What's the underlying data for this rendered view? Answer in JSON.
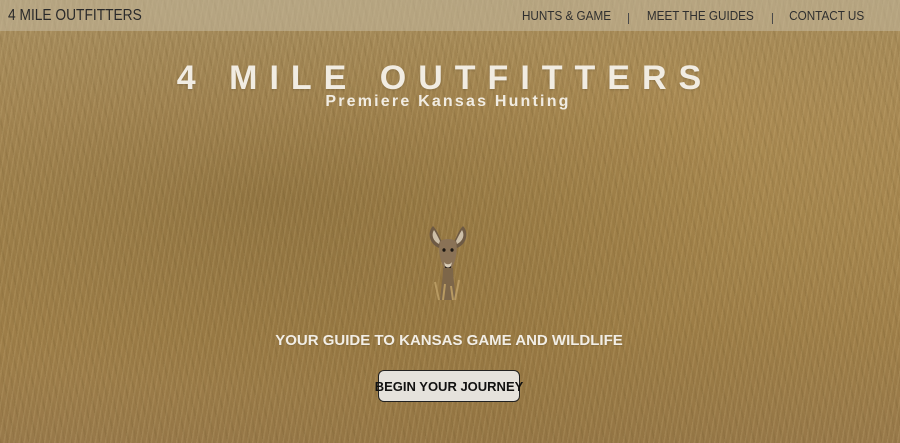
{
  "navbar": {
    "brand": "4 MILE OUTFITTERS",
    "links": [
      {
        "label": "HUNTS & GAME"
      },
      {
        "label": "MEET THE GUIDES"
      },
      {
        "label": "CONTACT US"
      }
    ]
  },
  "hero": {
    "title": "4 MILE OUTFITTERS",
    "subtitle": "Premiere Kansas Hunting",
    "tagline": "YOUR GUIDE TO KANSAS GAME AND WILDLIFE",
    "cta_label": "BEGIN YOUR JOURNEY",
    "image_subject": "deer-in-wheat-field"
  },
  "colors": {
    "hero_text": "#f1ece2",
    "navbar_bg": "#c4baa0",
    "button_bg": "#e5e2dc"
  }
}
